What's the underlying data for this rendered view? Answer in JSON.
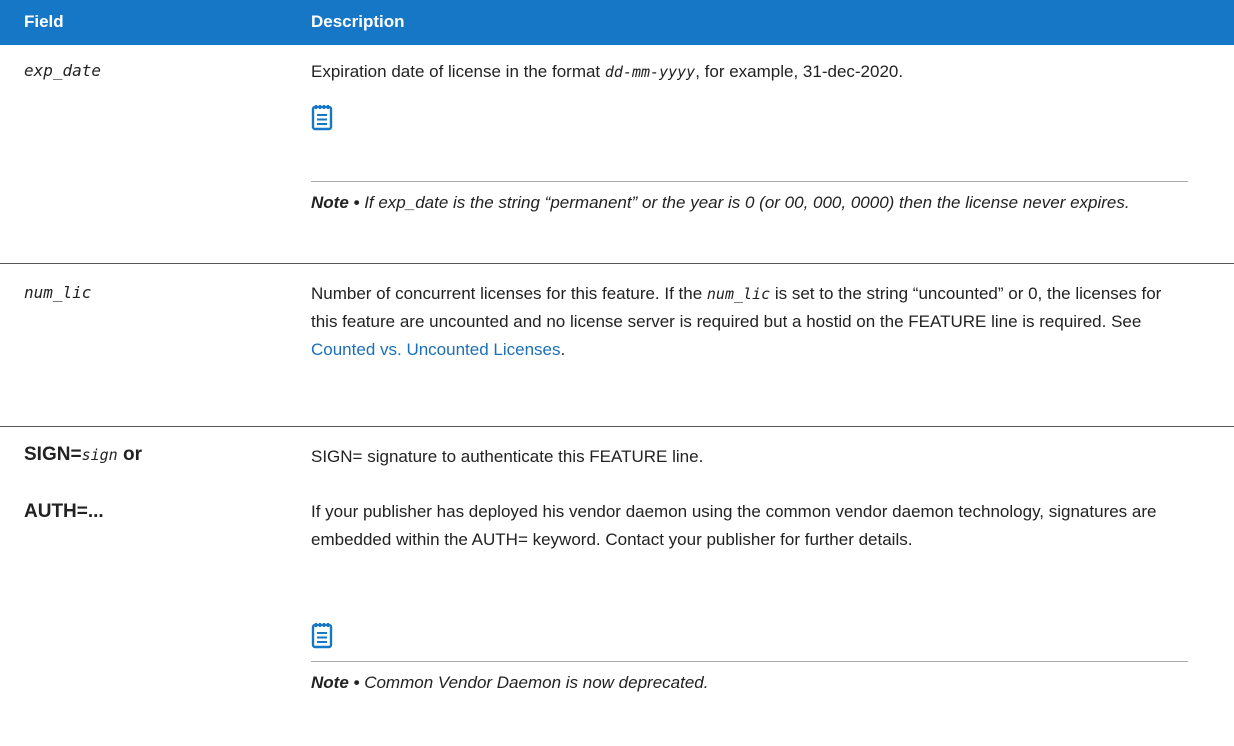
{
  "header": {
    "field": "Field",
    "description": "Description"
  },
  "rows": {
    "exp": {
      "field": "exp_date",
      "desc_pre": "Expiration date of license in the format ",
      "desc_fmt": "dd-mm-yyyy",
      "desc_post": ", for example, 31-dec-2020.",
      "note_label": "Note • ",
      "note_text": "If exp_date is the string “permanent” or the year is 0 (or 00, 000, 0000) then the license never expires."
    },
    "num": {
      "field": "num_lic",
      "desc_pre": "Number of concurrent licenses for this feature. If the ",
      "desc_code": "num_lic",
      "desc_post": " is set to the string “uncounted” or 0, the licenses for this feature are uncounted and no license server is required but a hostid on the FEATURE line is required. See ",
      "link": "Counted vs. Uncounted Licenses",
      "desc_end": "."
    },
    "sign": {
      "field_a_bold": "SIGN=",
      "field_a_ital": "sign",
      "field_a_or": " or",
      "field_b": "AUTH=...",
      "desc1": "SIGN= signature to authenticate this FEATURE line.",
      "desc2": "If your publisher has deployed his vendor daemon using the common vendor daemon technology, signatures are embedded within the AUTH= keyword. Contact your publisher for further details.",
      "note_label": "Note • ",
      "note_text": "Common Vendor Daemon is now deprecated."
    }
  },
  "colors": {
    "header_bg": "#1777c7",
    "link": "#1c6fb8",
    "note_icon": "#1777c7"
  },
  "icons": {
    "note": "note-icon"
  }
}
